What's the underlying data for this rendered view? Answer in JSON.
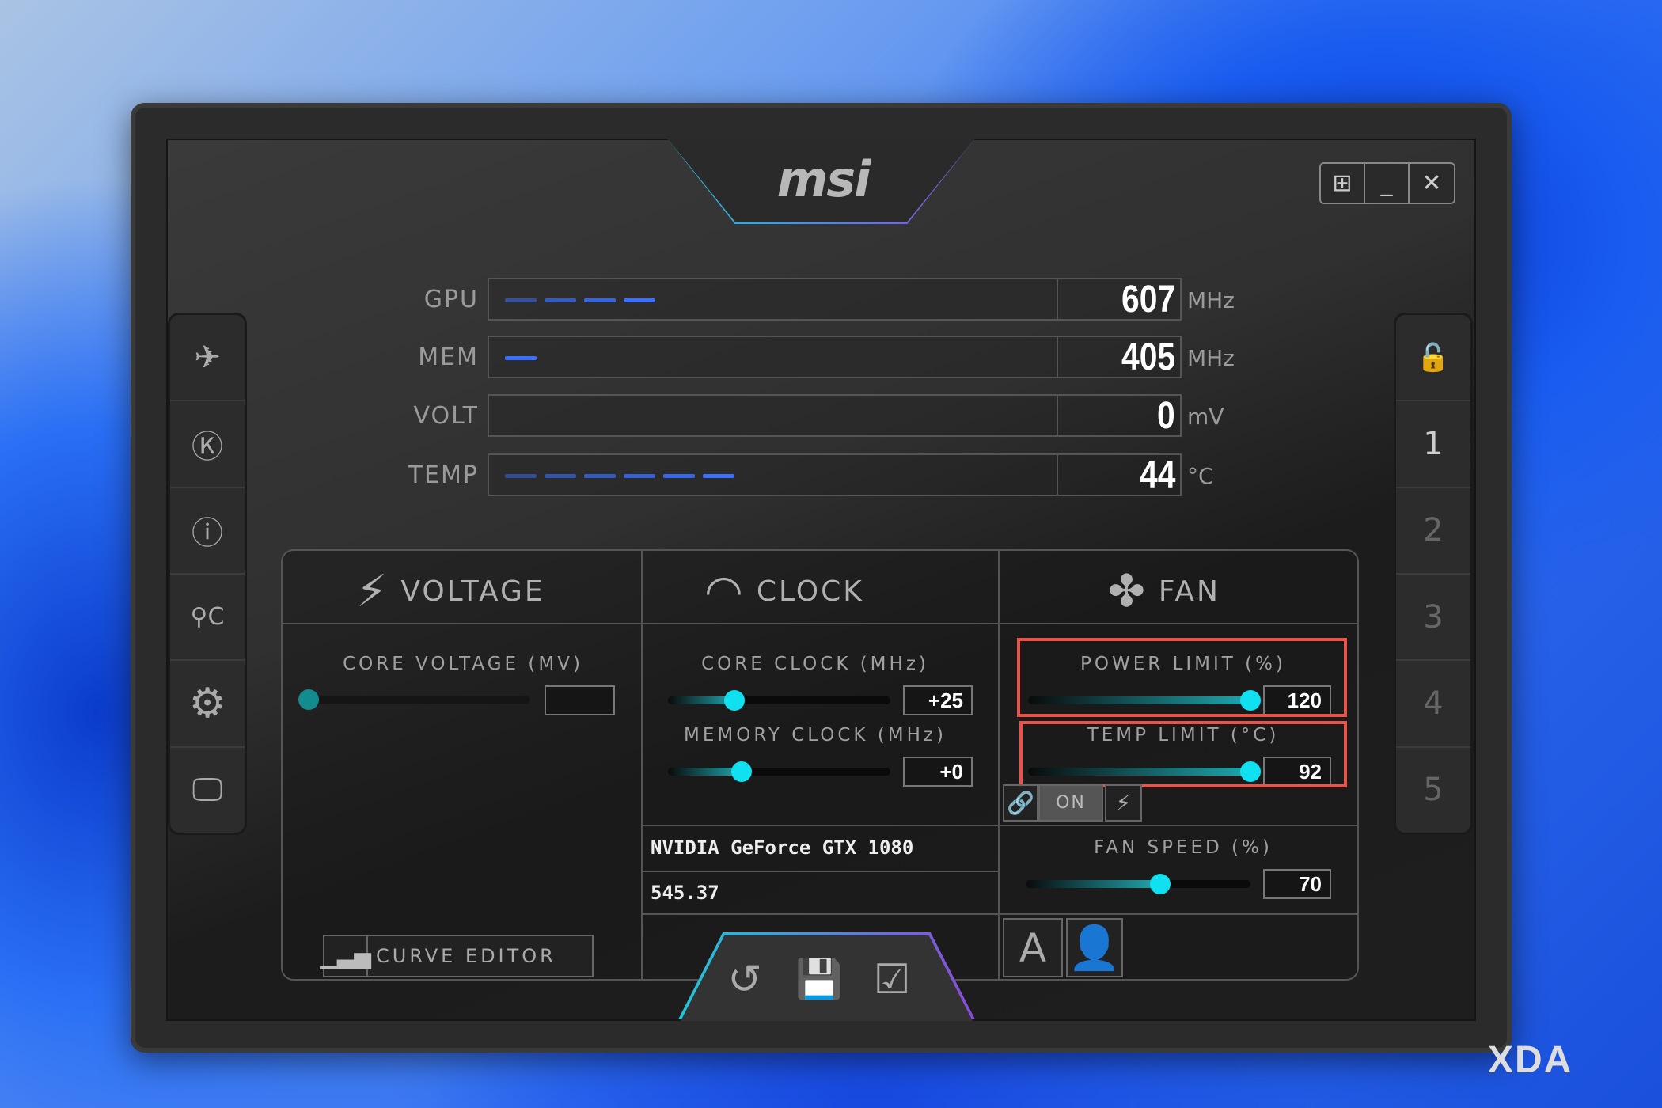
{
  "brand": "msi",
  "window_buttons": [
    {
      "icon": "windows-icon",
      "glyph": "⊞"
    },
    {
      "icon": "minimize-icon",
      "glyph": "_"
    },
    {
      "icon": "close-icon",
      "glyph": "✕"
    }
  ],
  "left_sidebar": [
    {
      "icon": "msi-dragon-icon",
      "glyph": "✈"
    },
    {
      "icon": "kombustor-icon",
      "glyph": "Ⓚ"
    },
    {
      "icon": "info-icon",
      "glyph": "ⓘ"
    },
    {
      "icon": "oc-scanner-icon",
      "glyph": "⚲C"
    },
    {
      "icon": "settings-gear-icon",
      "glyph": "⚙"
    },
    {
      "icon": "monitor-icon",
      "glyph": "🖵"
    }
  ],
  "right_sidebar": [
    {
      "icon": "lock-icon",
      "glyph": "🔓"
    },
    {
      "label": "1"
    },
    {
      "label": "2"
    },
    {
      "label": "3"
    },
    {
      "label": "4"
    },
    {
      "label": "5"
    }
  ],
  "monitor": [
    {
      "label": "GPU",
      "value": "607",
      "unit": "MHz",
      "segments": 4
    },
    {
      "label": "MEM",
      "value": "405",
      "unit": "MHz",
      "segments": 1
    },
    {
      "label": "VOLT",
      "value": "0",
      "unit": "mV",
      "segments": 0
    },
    {
      "label": "TEMP",
      "value": "44",
      "unit": "°C",
      "segments": 6
    }
  ],
  "sections": {
    "voltage": "VOLTAGE",
    "clock": "CLOCK",
    "fan": "FAN"
  },
  "core_voltage": {
    "label": "CORE VOLTAGE (MV)",
    "value": "",
    "level": 0
  },
  "core_clock": {
    "label": "CORE CLOCK (MHz)",
    "value": "+25",
    "level": 0.3
  },
  "memory_clock": {
    "label": "MEMORY CLOCK (MHz)",
    "value": "+0",
    "level": 0.33
  },
  "power_limit": {
    "label": "POWER LIMIT (%)",
    "value": "120",
    "level": 1.0
  },
  "temp_limit": {
    "label": "TEMP LIMIT (°C)",
    "value": "92",
    "level": 1.0
  },
  "link_toggle": {
    "label": "ON"
  },
  "gpu_name": "NVIDIA GeForce GTX 1080",
  "driver_version": "545.37",
  "fan_speed": {
    "label": "FAN SPEED (%)",
    "value": "70",
    "level": 0.6
  },
  "fan_auto_label": "A",
  "curve_editor_label": "CURVE EDITOR",
  "highlight_color": "#e8534a",
  "accent_color": "#10e0f0",
  "watermark": "XDA"
}
